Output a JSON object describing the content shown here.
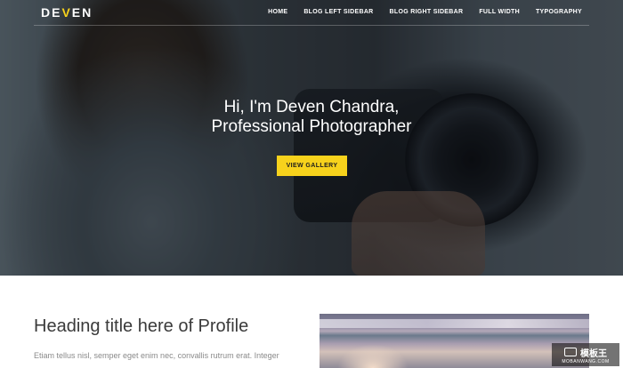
{
  "brand": {
    "prefix": "DE",
    "accent": "V",
    "suffix": "EN"
  },
  "nav": {
    "items": [
      "HOME",
      "BLOG LEFT SIDEBAR",
      "BLOG RIGHT SIDEBAR",
      "FULL WIDTH",
      "TYPOGRAPHY"
    ]
  },
  "hero": {
    "title_line1": "Hi, I'm Deven Chandra,",
    "title_line2": "Professional Photographer",
    "button_label": "VIEW GALLERY"
  },
  "profile": {
    "heading": "Heading title here of Profile",
    "text": "Etiam tellus nisl, semper eget enim nec, convallis rutrum erat. Integer"
  },
  "watermark": {
    "title": "模板王",
    "subtitle": "MOBANWANG.COM"
  },
  "colors": {
    "accent": "#f7d21c",
    "heading": "#3a3a3a",
    "body_text": "#8a8a8a"
  }
}
